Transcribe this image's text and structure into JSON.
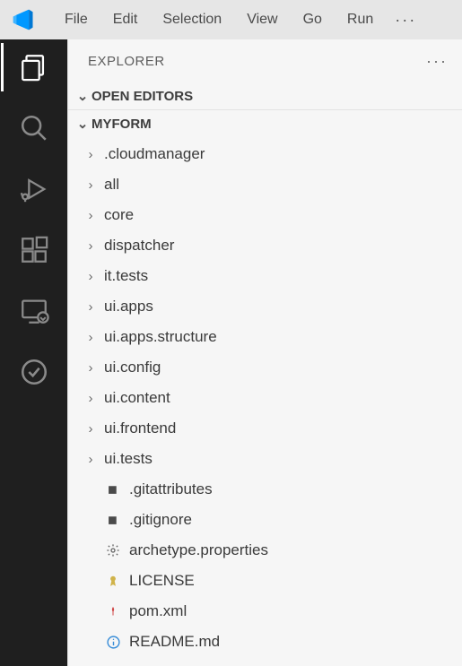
{
  "menubar": {
    "items": [
      "File",
      "Edit",
      "Selection",
      "View",
      "Go",
      "Run"
    ],
    "overflow": "···"
  },
  "activitybar": {
    "items": [
      {
        "name": "explorer",
        "active": true
      },
      {
        "name": "search",
        "active": false
      },
      {
        "name": "run-debug",
        "active": false
      },
      {
        "name": "extensions",
        "active": false
      },
      {
        "name": "remote",
        "active": false
      },
      {
        "name": "test",
        "active": false
      }
    ]
  },
  "sidebar": {
    "title": "EXPLORER",
    "sections": {
      "openEditors": {
        "label": "OPEN EDITORS",
        "expanded": true
      },
      "workspace": {
        "label": "MYFORM",
        "expanded": true
      }
    },
    "tree": [
      {
        "type": "folder",
        "name": ".cloudmanager"
      },
      {
        "type": "folder",
        "name": "all"
      },
      {
        "type": "folder",
        "name": "core"
      },
      {
        "type": "folder",
        "name": "dispatcher"
      },
      {
        "type": "folder",
        "name": "it.tests"
      },
      {
        "type": "folder",
        "name": "ui.apps"
      },
      {
        "type": "folder",
        "name": "ui.apps.structure"
      },
      {
        "type": "folder",
        "name": "ui.config"
      },
      {
        "type": "folder",
        "name": "ui.content"
      },
      {
        "type": "folder",
        "name": "ui.frontend"
      },
      {
        "type": "folder",
        "name": "ui.tests"
      },
      {
        "type": "file",
        "name": ".gitattributes",
        "icon": "git"
      },
      {
        "type": "file",
        "name": ".gitignore",
        "icon": "git"
      },
      {
        "type": "file",
        "name": "archetype.properties",
        "icon": "gear"
      },
      {
        "type": "file",
        "name": "LICENSE",
        "icon": "license"
      },
      {
        "type": "file",
        "name": "pom.xml",
        "icon": "xml"
      },
      {
        "type": "file",
        "name": "README.md",
        "icon": "info"
      }
    ]
  }
}
